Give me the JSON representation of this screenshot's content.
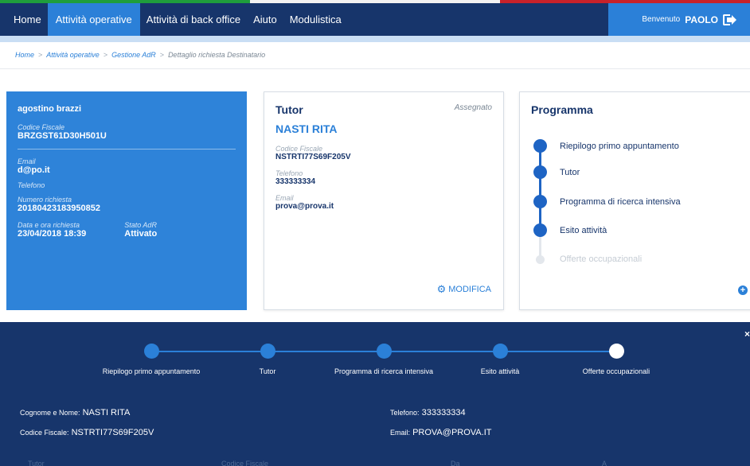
{
  "nav": {
    "items": [
      {
        "label": "Home",
        "active": false
      },
      {
        "label": "Attività operative",
        "active": true
      },
      {
        "label": "Attività di back office",
        "active": false
      },
      {
        "label": "Aiuto",
        "active": false
      },
      {
        "label": "Modulistica",
        "active": false
      }
    ],
    "welcome": "Benvenuto",
    "user": "PAOLO"
  },
  "breadcrumb": [
    "Home",
    "Attività operative",
    "Gestione AdR",
    "Dettaglio richiesta Destinatario"
  ],
  "beneficiary": {
    "name": "agostino brazzi",
    "cf_label": "Codice Fiscale",
    "cf": "BRZGST61D30H501U",
    "email_label": "Email",
    "email": "d@po.it",
    "phone_label": "Telefono",
    "phone": "",
    "req_label": "Numero richiesta",
    "req": "20180423183950852",
    "date_label": "Data e ora richiesta",
    "date": "23/04/2018 18:39",
    "status_label": "Stato AdR",
    "status": "Attivato"
  },
  "tutor": {
    "title": "Tutor",
    "assigned": "Assegnato",
    "name": "NASTI RITA",
    "cf_label": "Codice Fiscale",
    "cf": "NSTRTI77S69F205V",
    "phone_label": "Telefono",
    "phone": "333333334",
    "email_label": "Email",
    "email": "prova@prova.it",
    "modify": "MODIFICA"
  },
  "programma": {
    "title": "Programma",
    "steps": [
      {
        "label": "Riepilogo primo appuntamento",
        "done": true
      },
      {
        "label": "Tutor",
        "done": true
      },
      {
        "label": "Programma di ricerca intensiva",
        "done": true
      },
      {
        "label": "Esito attività",
        "done": true
      },
      {
        "label": "Offerte occupazionali",
        "done": false
      }
    ]
  },
  "bottom": {
    "steps": [
      "Riepilogo primo appuntamento",
      "Tutor",
      "Programma di ricerca intensiva",
      "Esito attività",
      "Offerte occupazionali"
    ],
    "name_label": "Cognome e Nome:",
    "name": "NASTI RITA",
    "cf_label": "Codice Fiscale:",
    "cf": "NSTRTI77S69F205V",
    "phone_label": "Telefono:",
    "phone": "333333334",
    "email_label": "Email:",
    "email": "PROVA@PROVA.IT",
    "table_headers": [
      "Tutor",
      "Codice Fiscale",
      "Da",
      "A"
    ]
  }
}
